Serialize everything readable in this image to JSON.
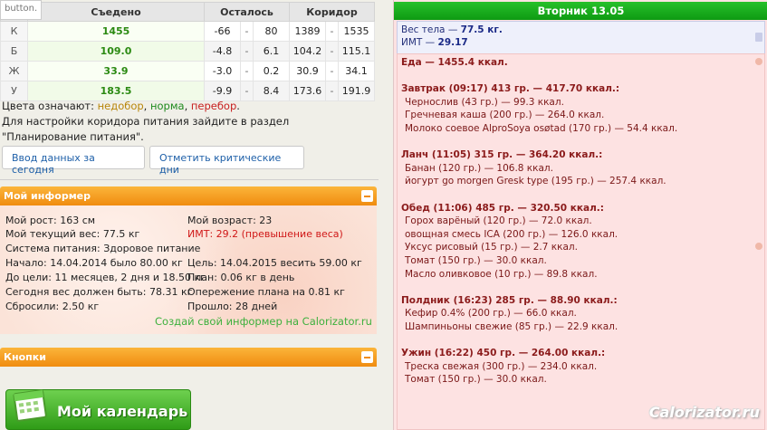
{
  "tooltip": "button.",
  "table": {
    "headers": [
      "",
      "Съедено",
      "Осталось",
      "Коридор"
    ],
    "rows": [
      {
        "label": "К",
        "eaten": "1455",
        "rem_from": "-66",
        "rem_to": "80",
        "cor_from": "1389",
        "cor_to": "1535"
      },
      {
        "label": "Б",
        "eaten": "109.0",
        "rem_from": "-4.8",
        "rem_to": "6.1",
        "cor_from": "104.2",
        "cor_to": "115.1"
      },
      {
        "label": "Ж",
        "eaten": "33.9",
        "rem_from": "-3.0",
        "rem_to": "0.2",
        "cor_from": "30.9",
        "cor_to": "34.1"
      },
      {
        "label": "У",
        "eaten": "183.5",
        "rem_from": "-9.9",
        "rem_to": "8.4",
        "cor_from": "173.6",
        "cor_to": "191.9"
      }
    ],
    "dash": "-"
  },
  "legend": {
    "prefix": "Цвета означают: ",
    "nedobor": "недобор",
    "norma": "норма",
    "perebor": "перебор",
    "sep": ", ",
    "end": ".",
    "note": "Для настройки коридора питания зайдите в раздел \"Планирование питания\"."
  },
  "buttons": {
    "enter_today": "Ввод данных за сегодня",
    "mark_critical": "Отметить критические дни"
  },
  "informer": {
    "title": "Мой информер",
    "height": "Мой рост: 163 см",
    "age": "Мой возраст: 23",
    "weight": "Мой текущий вес: 77.5 кг",
    "bmi": "ИМТ: 29.2 (превышение веса)",
    "system": "Система питания: Здоровое питание",
    "start": "Начало: 14.04.2014 было 80.00 кг",
    "goal": "Цель: 14.04.2015 весить 59.00 кг",
    "to_goal": "До цели: 11 месяцев, 2 дня и 18.50 кг",
    "plan": "План: 0.06 кг в день",
    "should_weigh": "Сегодня вес должен быть: 78.31 кг",
    "ahead": "Опережение плана на 0.81 кг",
    "dropped": "Сбросили: 2.50 кг",
    "passed": "Прошло: 28 дней",
    "create_link": "Создай свой информер на Calorizator.ru"
  },
  "buttons_panel": {
    "title": "Кнопки",
    "calendar": "Мой календарь"
  },
  "day": {
    "title": "Вторник 13.05",
    "weight_label": "Вес тела — ",
    "weight_value": "77.5 кг.",
    "bmi_label": "ИМТ — ",
    "bmi_value": "29.17",
    "food_total": "Еда — 1455.4 ккал.",
    "meals": [
      {
        "header": "Завтрак (09:17) 413 гр. — 417.70 ккал.:",
        "items": [
          "Чернослив (43 гр.) — 99.3 ккал.",
          "Гречневая каша (200 гр.) — 264.0 ккал.",
          "Молоко соевое AlproSoya osøtad (170 гр.) — 54.4 ккал."
        ]
      },
      {
        "header": "Ланч (11:05) 315 гр. — 364.20 ккал.:",
        "items": [
          "Банан (120 гр.) — 106.8 ккал.",
          "йогурт go morgen Gresk type (195 гр.) — 257.4 ккал."
        ]
      },
      {
        "header": "Обед (11:06) 485 гр. — 320.50 ккал.:",
        "items": [
          "Горох варёный (120 гр.) — 72.0 ккал.",
          "овощная смесь ICA (200 гр.) — 126.0 ккал.",
          "Уксус рисовый (15 гр.) — 2.7 ккал.",
          "Томат (150 гр.) — 30.0 ккал.",
          "Масло оливковое (10 гр.) — 89.8 ккал."
        ]
      },
      {
        "header": "Полдник (16:23) 285 гр. — 88.90 ккал.:",
        "items": [
          "Кефир 0.4% (200 гр.) — 66.0 ккал.",
          "Шампиньоны свежие (85 гр.) — 22.9 ккал."
        ]
      },
      {
        "header": "Ужин (16:22) 450 гр. — 264.00 ккал.:",
        "items": [
          "Треска свежая (300 гр.) — 234.0 ккал.",
          "Томат (150 гр.) — 30.0 ккал."
        ]
      }
    ]
  },
  "watermark": "Calorizator.ru",
  "colors": {
    "accent_orange": "#f08c10",
    "accent_green": "#0e9a12",
    "food_bg": "#fde2e2"
  }
}
